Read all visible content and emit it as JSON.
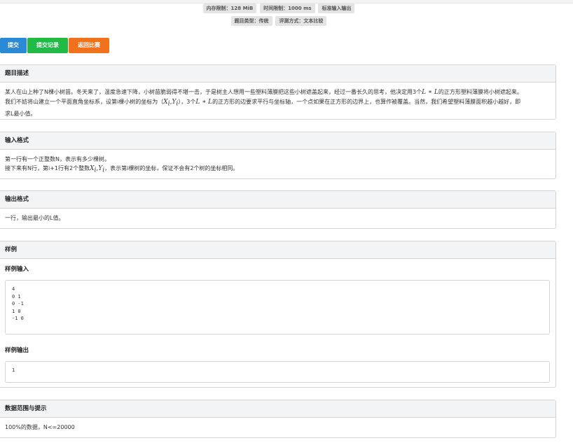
{
  "header": {
    "row1": [
      "内存限制：128 MiB",
      "时间限制：1000 ms",
      "标准输入输出"
    ],
    "row2": [
      "题目类型：传统",
      "评测方式：文本比较"
    ]
  },
  "actions": {
    "submit": "提交",
    "records": "提交记录",
    "back": "返回比赛"
  },
  "description": {
    "title": "题目描述",
    "line1_a": "某人在山上种了N棵小树苗。冬天来了，温度急速下降，小树苗脆弱得不堪一击，于是树主人想用一些塑料薄膜把这些小树遮盖起来，经过一番长久的思考，他决定用3个",
    "line1_math": "L ∗ L",
    "line1_b": "的正方形塑料薄膜将小树遮起来。",
    "line2_a": "我们不妨将山建立一个平面直角坐标系，设第i棵小树的坐标为（",
    "line2_math1": "X",
    "line2_sub1": "i",
    "line2_comma": ",",
    "line2_math2": "Y",
    "line2_sub2": "i",
    "line2_b": "），3个",
    "line2_math3": "L ∗ L",
    "line2_c": "的正方形的边要求平行与坐标轴，一个点如果在正方形的边界上，也算作被覆盖。当然，我们希望塑料薄膜面积越小越好，即",
    "line3": "求L最小值。"
  },
  "input_format": {
    "title": "输入格式",
    "line1": "第一行有一个正整数N，表示有多少棵树。",
    "line2_a": "接下来有N行，第i+1行有2个整数",
    "line2_math1": "X",
    "line2_sub1": "i",
    "line2_comma": ",",
    "line2_math2": "Y",
    "line2_sub2": "i",
    "line2_b": "，表示第i棵树的坐标，保证不会有2个树的坐标相同。"
  },
  "output_format": {
    "title": "输出格式",
    "line1": "一行，输出最小的L值。"
  },
  "sample": {
    "title": "样例",
    "input_title": "样例输入",
    "input_lines": [
      "4",
      "0 1",
      "0 -1",
      "1 0",
      "-1 0"
    ],
    "output_title": "样例输出",
    "output_lines": [
      "1"
    ]
  },
  "range": {
    "title": "数据范围与提示",
    "line1": "100%的数据，N<=20000"
  }
}
